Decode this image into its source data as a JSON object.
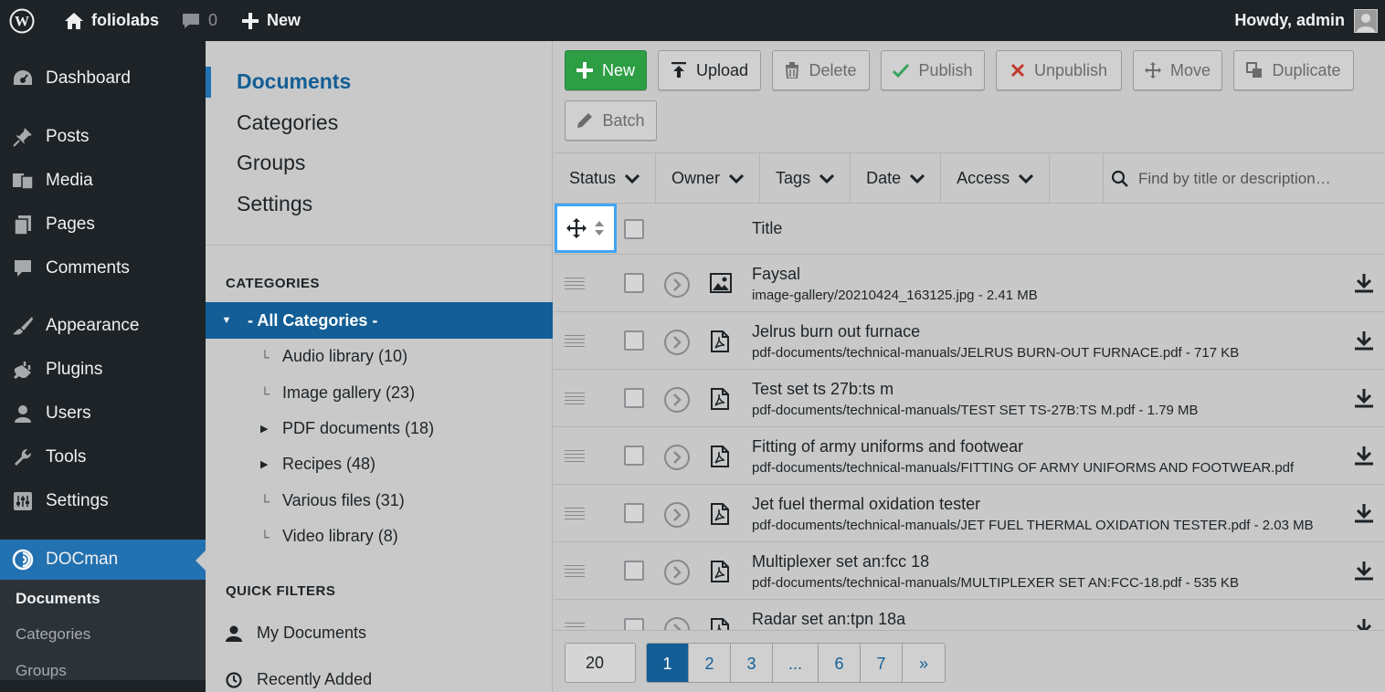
{
  "adminbar": {
    "site_name": "foliolabs",
    "comments_count": "0",
    "new_label": "New",
    "greeting": "Howdy, admin"
  },
  "adminmenu": {
    "items": [
      {
        "label": "Dashboard",
        "icon": "dashboard-icon"
      },
      {
        "label": "Posts",
        "icon": "pin-icon"
      },
      {
        "label": "Media",
        "icon": "media-icon"
      },
      {
        "label": "Pages",
        "icon": "pages-icon"
      },
      {
        "label": "Comments",
        "icon": "comment-icon"
      },
      {
        "label": "Appearance",
        "icon": "brush-icon"
      },
      {
        "label": "Plugins",
        "icon": "plug-icon"
      },
      {
        "label": "Users",
        "icon": "user-icon"
      },
      {
        "label": "Tools",
        "icon": "wrench-icon"
      },
      {
        "label": "Settings",
        "icon": "settings-icon"
      },
      {
        "label": "DOCman",
        "icon": "docman-icon"
      }
    ],
    "submenu": [
      "Documents",
      "Categories",
      "Groups"
    ]
  },
  "docman_nav": [
    "Documents",
    "Categories",
    "Groups",
    "Settings"
  ],
  "categories": {
    "title": "CATEGORIES",
    "all_label": "- All Categories -",
    "items": [
      {
        "label": "Audio library (10)",
        "has_children": false
      },
      {
        "label": "Image gallery (23)",
        "has_children": false
      },
      {
        "label": "PDF documents (18)",
        "has_children": true
      },
      {
        "label": "Recipes (48)",
        "has_children": true
      },
      {
        "label": "Various files (31)",
        "has_children": false
      },
      {
        "label": "Video library (8)",
        "has_children": false
      }
    ]
  },
  "quick_filters": {
    "title": "QUICK FILTERS",
    "items": [
      "My Documents",
      "Recently Added"
    ]
  },
  "toolbar": {
    "new": "New",
    "upload": "Upload",
    "delete": "Delete",
    "publish": "Publish",
    "unpublish": "Unpublish",
    "move": "Move",
    "duplicate": "Duplicate",
    "batch": "Batch"
  },
  "filters": [
    "Status",
    "Owner",
    "Tags",
    "Date",
    "Access"
  ],
  "search": {
    "placeholder": "Find by title or description…"
  },
  "table": {
    "title_header": "Title",
    "rows": [
      {
        "title": "Faysal",
        "path": "image-gallery/20210424_163125.jpg - 2.41 MB",
        "type": "image"
      },
      {
        "title": "Jelrus burn out furnace",
        "path": "pdf-documents/technical-manuals/JELRUS BURN-OUT FURNACE.pdf - 717 KB",
        "type": "pdf"
      },
      {
        "title": "Test set ts 27b:ts m",
        "path": "pdf-documents/technical-manuals/TEST SET TS-27B:TS M.pdf - 1.79 MB",
        "type": "pdf"
      },
      {
        "title": "Fitting of army uniforms and footwear",
        "path": "pdf-documents/technical-manuals/FITTING OF ARMY UNIFORMS AND FOOTWEAR.pdf",
        "type": "pdf"
      },
      {
        "title": "Jet fuel thermal oxidation tester",
        "path": "pdf-documents/technical-manuals/JET FUEL THERMAL OXIDATION TESTER.pdf - 2.03 MB",
        "type": "pdf"
      },
      {
        "title": "Multiplexer set an:fcc 18",
        "path": "pdf-documents/technical-manuals/MULTIPLEXER SET AN:FCC-18.pdf - 535 KB",
        "type": "pdf"
      },
      {
        "title": "Radar set an:tpn 18a",
        "path": "",
        "type": "pdf"
      }
    ]
  },
  "pagination": {
    "limit": "20",
    "pages": [
      "1",
      "2",
      "3",
      "...",
      "6",
      "7",
      "»"
    ],
    "active": "1"
  },
  "colors": {
    "admin_dark": "#1d2327",
    "accent_blue": "#135e96",
    "new_green": "#2e9e44",
    "highlight": "#42a5f5"
  }
}
